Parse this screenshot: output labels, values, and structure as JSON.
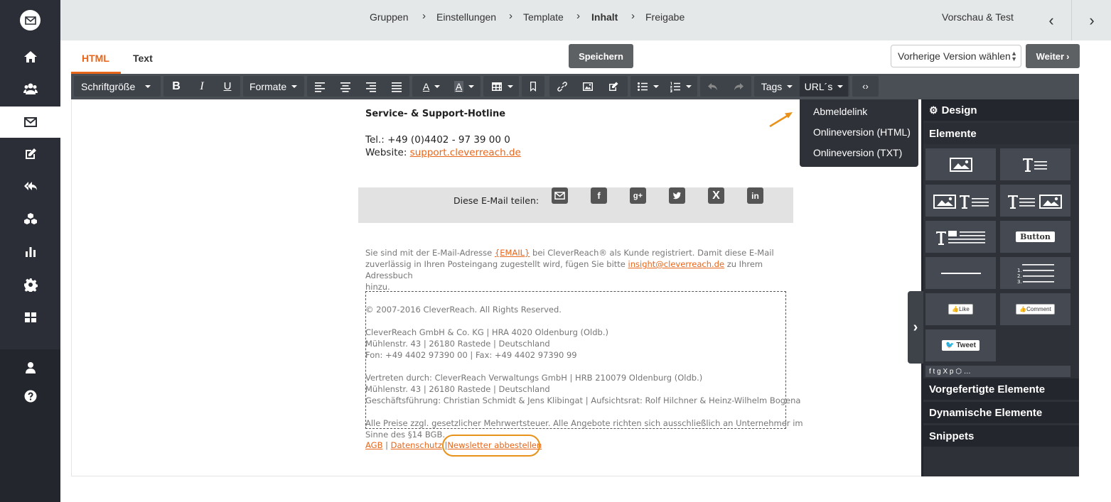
{
  "breadcrumb": {
    "items": [
      "Gruppen",
      "Einstellungen",
      "Template",
      "Inhalt",
      "Freigabe"
    ],
    "active": "Inhalt"
  },
  "header": {
    "preview_label": "Vorschau & Test",
    "prev_arrow": "‹",
    "next_arrow": "›"
  },
  "tabs": [
    {
      "label": "HTML",
      "active": true
    },
    {
      "label": "Text",
      "active": false
    }
  ],
  "actions": {
    "save_label": "Speichern",
    "version_select": "Vorherige Version wählen",
    "next_label": "Weiter"
  },
  "toolbar": {
    "font_size": "Schriftgröße",
    "formats": "Formate",
    "tags": "Tags",
    "urls": "URL´s",
    "text_color_letter": "A"
  },
  "urls_menu": [
    "Abmeldelink",
    "Onlineversion (HTML)",
    "Onlineversion (TXT)"
  ],
  "email": {
    "hotline_title": "Service- & Support-Hotline",
    "phone": "Tel.: +49 (0)4402 - 97 39 00 0",
    "website_label": "Website: ",
    "website_link": "support.cleverreach.de",
    "share_label": "Diese E-Mail teilen:",
    "notice_1": "Sie sind mit der E-Mail-Adresse ",
    "notice_placeholder": "{EMAIL}",
    "notice_2": "  bei CleverReach® als Kunde registriert. Damit diese E-Mail",
    "notice_3": "zuverlässig in Ihren Posteingang zugestellt wird, fügen Sie bitte ",
    "notice_email": "insight@cleverreach.de",
    "notice_4": "  zu Ihrem Adressbuch",
    "notice_5": "hinzu.",
    "footer_lines": [
      "© 2007-2016 CleverReach. All Rights Reserved.",
      "",
      "CleverReach GmbH & Co. KG | HRA 4020 Oldenburg (Oldb.)",
      "Mühlenstr. 43 | 26180 Rastede | Deutschland",
      "Fon: +49 4402 97390 00 | Fax: +49 4402 97390 99",
      "",
      "Vertreten durch: CleverReach Verwaltungs GmbH | HRB 210079 Oldenburg (Oldb.)",
      "Mühlenstr. 43 | 26180 Rastede | Deutschland",
      "Geschäftsführung: Christian Schmidt & Jens Klibingat | Aufsichtsrat: Rolf Hilchner & Heinz-Wilhelm Bogena",
      "",
      "Alle Preise zzgl. gesetzlicher Mehrwertsteuer. Alle Angebote richten sich ausschließlich an Unternehmer im",
      "Sinne des §14 BGB."
    ],
    "links": {
      "agb": "AGB",
      "privacy": "Datenschutz",
      "unsubscribe": "Newsletter abbestellen",
      "sep": "|"
    }
  },
  "right_panel": {
    "design": "Design",
    "elements": "Elemente",
    "prebuilt": "Vorgefertigte Elemente",
    "dynamic": "Dynamische Elemente",
    "snippets": "Snippets",
    "button_tile": "Button",
    "like_tile": "Like",
    "comment_tile": "Comment",
    "tweet_tile": "Tweet"
  },
  "colors": {
    "accent": "#e8661a",
    "sidebar": "#2b2e36",
    "toolbar": "#4a4f55",
    "panel": "#2e3238"
  }
}
